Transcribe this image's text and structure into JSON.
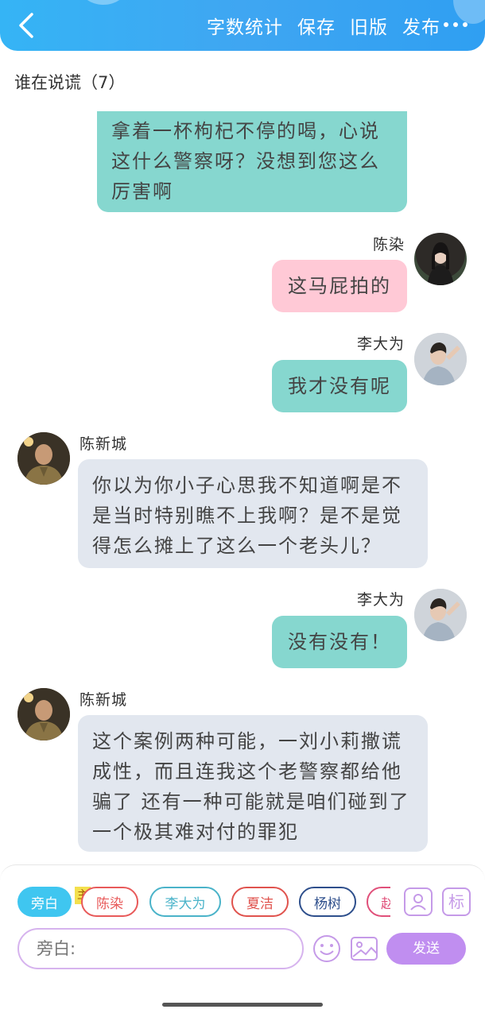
{
  "header": {
    "actions": [
      "字数统计",
      "保存",
      "旧版",
      "发布"
    ]
  },
  "chat_title": "谁在说谎（7）",
  "messages": [
    {
      "text": "拿着一杯枸杞不停的喝，心说这什么警察呀？没想到您这么厉害啊"
    },
    {
      "name": "陈染",
      "text": "这马屁拍的"
    },
    {
      "name": "李大为",
      "text": "我才没有呢"
    },
    {
      "name": "陈新城",
      "text": "你以为你小子心思我不知道啊是不是当时特别瞧不上我啊？是不是觉得怎么摊上了这么一个老头儿？"
    },
    {
      "name": "李大为",
      "text": "没有没有！"
    },
    {
      "name": "陈新城",
      "text": "这个案例两种可能，一刘小莉撒谎成性，而且连我这个老警察都给他骗了 还有一种可能就是咱们碰到了一个极其难对付的罪犯"
    }
  ],
  "roles": [
    {
      "label": "旁白",
      "color": "#35c3ef"
    },
    {
      "label": "陈染",
      "color": "#e85a5a",
      "badge": "主"
    },
    {
      "label": "李大为",
      "color": "#4ab3c9"
    },
    {
      "label": "夏洁",
      "color": "#e0534e"
    },
    {
      "label": "杨树",
      "color": "#2e4f8c"
    },
    {
      "label": "赵",
      "color": "#e0507a"
    }
  ],
  "input": {
    "placeholder": "旁白:"
  },
  "send_label": "发送",
  "side_icon_label": "标",
  "colors": {
    "accent": "#3aa9f3",
    "send": "#c08ef0"
  }
}
